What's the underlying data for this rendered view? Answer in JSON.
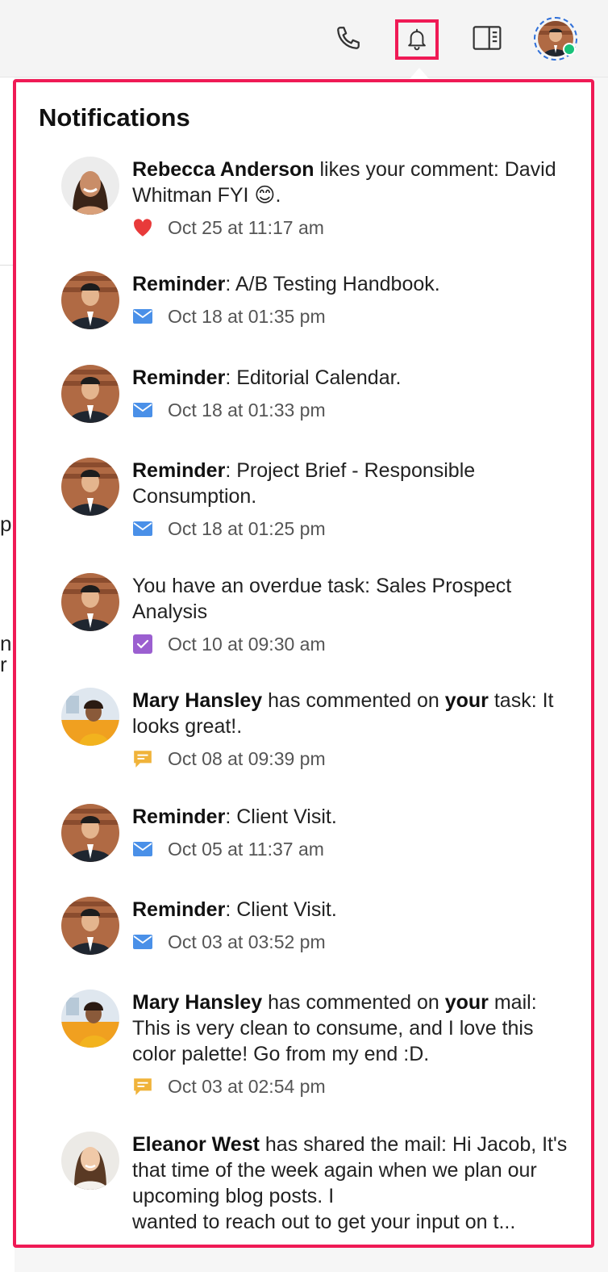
{
  "colors": {
    "highlight": "#ef1a55",
    "mail_icon": "#4a90e8",
    "task_icon": "#9b5fd0",
    "comment_icon": "#f0b33a",
    "heart_icon": "#e83a3a",
    "online": "#18c27a"
  },
  "header": {
    "icons": [
      "phone-icon",
      "bell-icon",
      "side-panel-icon",
      "user-avatar"
    ]
  },
  "background_fragments": [
    "p",
    "n",
    "r"
  ],
  "notifications": {
    "title": "Notifications",
    "items": [
      {
        "actor": "Rebecca Anderson",
        "text": " likes your comment: David Whitman FYI 😊.",
        "icon": "heart-icon",
        "time": "Oct 25 at 11:17 am"
      },
      {
        "actor": "Reminder",
        "text": ": A/B Testing Handbook.",
        "icon": "mail-icon",
        "time": "Oct 18 at 01:35 pm"
      },
      {
        "actor": "Reminder",
        "text": ": Editorial Calendar.",
        "icon": "mail-icon",
        "time": "Oct 18 at 01:33 pm"
      },
      {
        "actor": "Reminder",
        "text": ": Project Brief - Responsible Consumption.",
        "icon": "mail-icon",
        "time": "Oct 18 at 01:25 pm"
      },
      {
        "actor": "",
        "text": "You have an overdue task: Sales Prospect Analysis",
        "icon": "task-check-icon",
        "time": "Oct 10 at 09:30 am"
      },
      {
        "actor": "Mary Hansley",
        "text_a": " has commented on ",
        "emph": "your",
        "text_b": " task: It looks great!.",
        "icon": "comment-icon",
        "time": "Oct 08 at 09:39 pm"
      },
      {
        "actor": "Reminder",
        "text": ": Client Visit.",
        "icon": "mail-icon",
        "time": "Oct 05 at 11:37 am"
      },
      {
        "actor": "Reminder",
        "text": ": Client Visit.",
        "icon": "mail-icon",
        "time": "Oct 03 at 03:52 pm"
      },
      {
        "actor": "Mary Hansley",
        "text_a": " has commented on ",
        "emph": "your",
        "text_b": " mail: This is very clean to consume, and I love this color palette! Go from my end :D.",
        "icon": "comment-icon",
        "time": "Oct 03 at 02:54 pm"
      },
      {
        "actor": "Eleanor West",
        "text_l1": " has shared the mail: Hi Jacob, It's that time of the week again when we plan our upcoming blog posts. I",
        "text_l2": "wanted to reach out to get your input on t..."
      }
    ]
  }
}
